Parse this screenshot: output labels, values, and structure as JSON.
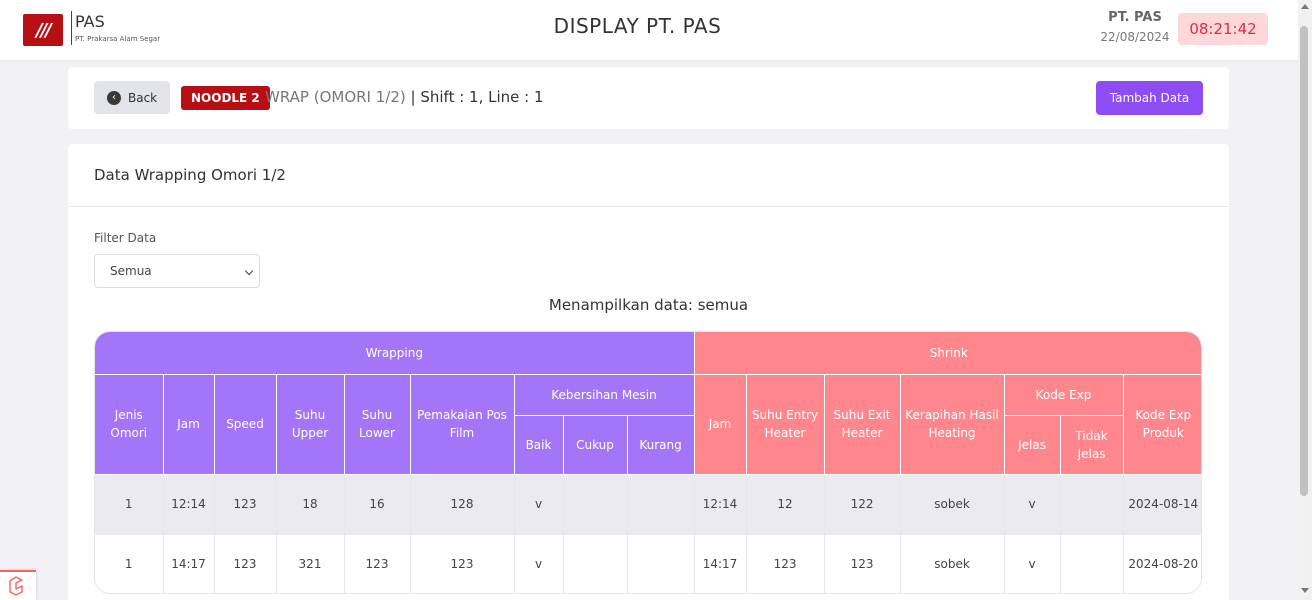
{
  "topbar": {
    "logo_mark": "///",
    "logo_name": "PAS",
    "logo_sub": "PT. Prakarsa Alam Segar",
    "title": "DISPLAY PT. PAS",
    "company": "PT. PAS",
    "date": "22/08/2024",
    "clock": "08:21:42"
  },
  "header": {
    "back_label": "Back",
    "badge": "NOODLE 2",
    "wrap_label": "WRAP (OMORI 1/2)",
    "shift_label": "| Shift : 1, Line : 1",
    "add_label": "Tambah Data"
  },
  "card": {
    "title": "Data Wrapping Omori 1/2",
    "filter_label": "Filter Data",
    "filter_value": "Semua",
    "showing": "Menampilkan data: semua"
  },
  "table": {
    "groups": {
      "wrapping": "Wrapping",
      "shrink": "Shrink"
    },
    "headers": {
      "jenis_omori": "Jenis Omori",
      "jam": "Jam",
      "speed": "Speed",
      "suhu_upper": "Suhu Upper",
      "suhu_lower": "Suhu Lower",
      "pemakaian": "Pemakaian Pos Film",
      "kebersihan": "Kebersihan Mesin",
      "baik": "Baik",
      "cukup": "Cukup",
      "kurang": "Kurang",
      "jam_shrink": "Jam",
      "suhu_entry": "Suhu Entry Heater",
      "suhu_exit": "Suhu Exit Heater",
      "kerapihan": "Kerapihan Hasil Heating",
      "kode_exp": "Kode Exp",
      "jelas": "Jelas",
      "tidak_jelas": "Tidak Jelas",
      "kode_exp_produk": "Kode Exp Produk"
    },
    "rows": [
      {
        "jenis": "1",
        "jam": "12:14",
        "speed": "123",
        "upper": "18",
        "lower": "16",
        "pos_film": "128",
        "baik": "v",
        "cukup": "",
        "kurang": "",
        "jam_shrink": "12:14",
        "entry": "12",
        "exit": "122",
        "kerapihan": "sobek",
        "jelas": "v",
        "tidak_jelas": "",
        "kode_exp_produk": "2024-08-14"
      },
      {
        "jenis": "1",
        "jam": "14:17",
        "speed": "123",
        "upper": "321",
        "lower": "123",
        "pos_film": "123",
        "baik": "v",
        "cukup": "",
        "kurang": "",
        "jam_shrink": "14:17",
        "entry": "123",
        "exit": "123",
        "kerapihan": "sobek",
        "jelas": "v",
        "tidak_jelas": "",
        "kode_exp_produk": "2024-08-20"
      }
    ]
  },
  "colors": {
    "brand_red": "#b80f14",
    "wrapping_header": "#a475f9",
    "shrink_header": "#fe868c",
    "primary_button": "#8e4cf4",
    "clock_bg": "#fed7d8"
  },
  "icons": {
    "back": "circle-arrow-left-icon",
    "select": "chevron-down-icon",
    "debug": "laravel-icon"
  }
}
